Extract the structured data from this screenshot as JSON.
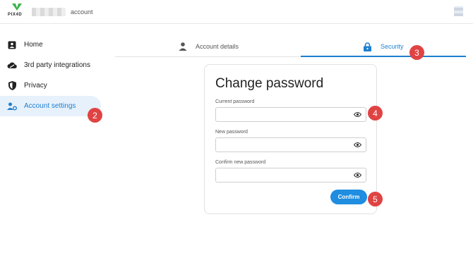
{
  "header": {
    "logo_text": "PIX4D",
    "title_word": "account"
  },
  "sidebar": {
    "items": [
      {
        "label": "Home",
        "icon": "home-icon"
      },
      {
        "label": "3rd party integrations",
        "icon": "cloud-link-icon"
      },
      {
        "label": "Privacy",
        "icon": "shield-icon"
      },
      {
        "label": "Account settings",
        "icon": "user-gear-icon",
        "active": true
      }
    ]
  },
  "tabs": [
    {
      "label": "Account details",
      "icon": "person-icon"
    },
    {
      "label": "Security",
      "icon": "lock-icon",
      "active": true
    }
  ],
  "form": {
    "title": "Change password",
    "fields": [
      {
        "label": "Current password",
        "value": "",
        "icon": "eye-icon"
      },
      {
        "label": "New password",
        "value": "",
        "icon": "eye-icon"
      },
      {
        "label": "Confirm new password",
        "value": "",
        "icon": "eye-icon"
      }
    ],
    "confirm_label": "Confirm"
  },
  "callouts": [
    "2",
    "3",
    "4",
    "5"
  ],
  "colors": {
    "accent": "#1e7fd0",
    "button": "#1f8de0",
    "active_bg": "#e7f1fb",
    "callout": "#e04343"
  }
}
